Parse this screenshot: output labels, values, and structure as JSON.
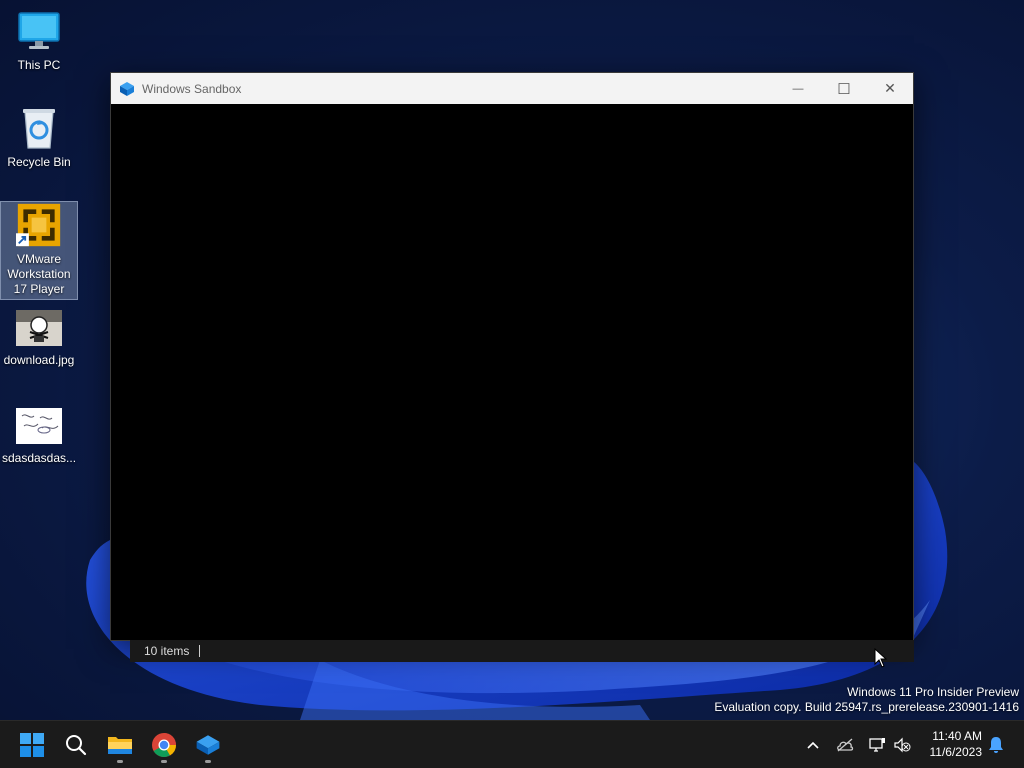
{
  "desktop": {
    "icons": [
      {
        "label": "This PC",
        "icon": "monitor-icon"
      },
      {
        "label": "Recycle Bin",
        "icon": "recycle-bin-icon"
      },
      {
        "label": "VMware Workstation 17 Player",
        "icon": "vmware-icon",
        "selected": true
      },
      {
        "label": "download.jpg",
        "icon": "image-file-icon"
      },
      {
        "label": "sdasdasdas...",
        "icon": "image-file-icon"
      }
    ]
  },
  "window": {
    "title": "Windows Sandbox",
    "minimize_glyph": "—",
    "maximize_glyph": "☐",
    "close_glyph": "✕"
  },
  "statusbar": {
    "items_text": "10 items"
  },
  "watermark": {
    "line1": "Windows 11 Pro Insider Preview",
    "line2": "Evaluation copy. Build 25947.rs_prerelease.230901-1416"
  },
  "taskbar": {
    "apps": [
      "start-icon",
      "search-icon",
      "file-explorer-icon",
      "chrome-icon",
      "windows-sandbox-icon"
    ],
    "tray": [
      "chevron-up-icon",
      "onedrive-icon",
      "network-icon",
      "volume-mute-icon"
    ],
    "time": "11:40 AM",
    "date": "11/6/2023",
    "notification_icon": "bell-icon"
  },
  "colors": {
    "accent": "#0a6fd6",
    "wallpaper": "#0c1c48"
  }
}
